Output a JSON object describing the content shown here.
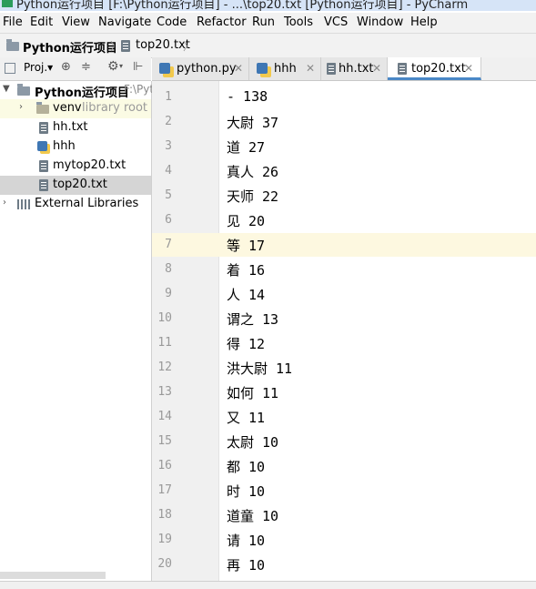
{
  "window": {
    "title": "Python运行项目 [F:\\Python运行项目] - ...\\top20.txt [Python运行项目] - PyCharm"
  },
  "menu": [
    "File",
    "Edit",
    "View",
    "Navigate",
    "Code",
    "Refactor",
    "Run",
    "Tools",
    "VCS",
    "Window",
    "Help"
  ],
  "breadcrumb": {
    "project": "Python运行项目",
    "file": "top20.txt"
  },
  "project_toolbar": {
    "label": "Proj.▾"
  },
  "tabs": [
    {
      "label": "python.py"
    },
    {
      "label": "hhh"
    },
    {
      "label": "hh.txt"
    },
    {
      "label": "top20.txt"
    }
  ],
  "tree": {
    "root": {
      "label": "Python运行项目",
      "path": "F:\\Pyt"
    },
    "venv": {
      "label": "venv",
      "note": "library root"
    },
    "files": [
      "hh.txt",
      "hhh",
      "mytop20.txt",
      "top20.txt"
    ],
    "external": "External Libraries"
  },
  "editor": {
    "lines": [
      "- 138",
      "大尉 37",
      "道 27",
      "真人 26",
      "天师 22",
      "见 20",
      "等 17",
      "着 16",
      "人 14",
      "谓之 13",
      "得 12",
      "洪大尉 11",
      "如何 11",
      "又 11",
      "太尉 10",
      "都 10",
      "时 10",
      "道童 10",
      "请 10",
      "再 10"
    ],
    "line_numbers": [
      "1",
      "2",
      "3",
      "4",
      "5",
      "6",
      "7",
      "8",
      "9",
      "10",
      "11",
      "12",
      "13",
      "14",
      "15",
      "16",
      "17",
      "18",
      "19",
      "20"
    ]
  },
  "colors": {
    "selection": "#d5d5d5",
    "caret_line": "#fdf8e0",
    "accent": "#4a88c7"
  }
}
